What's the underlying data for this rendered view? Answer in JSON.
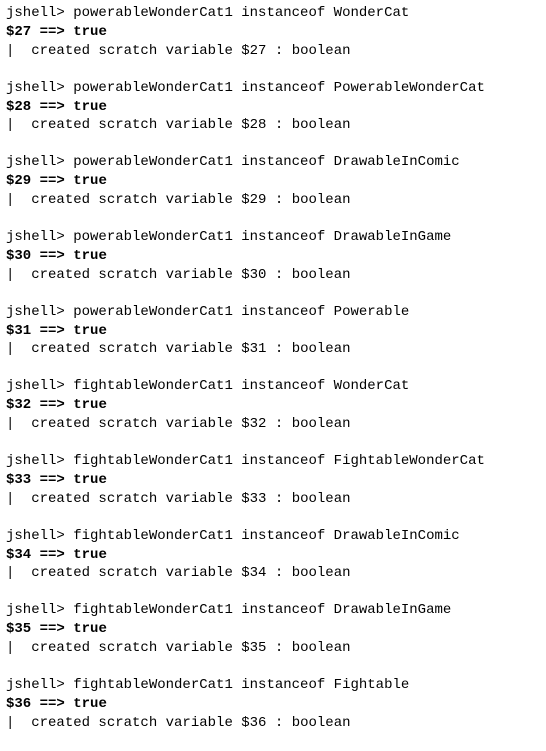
{
  "prompt": "jshell>",
  "arrow": "==>",
  "pipe": "|",
  "created_prefix": "  created scratch variable",
  "created_sep": " :",
  "entries": [
    {
      "cmd": "powerableWonderCat1 instanceof WonderCat",
      "var": "$27",
      "val": "true",
      "type": "boolean"
    },
    {
      "cmd": "powerableWonderCat1 instanceof PowerableWonderCat",
      "var": "$28",
      "val": "true",
      "type": "boolean"
    },
    {
      "cmd": "powerableWonderCat1 instanceof DrawableInComic",
      "var": "$29",
      "val": "true",
      "type": "boolean"
    },
    {
      "cmd": "powerableWonderCat1 instanceof DrawableInGame",
      "var": "$30",
      "val": "true",
      "type": "boolean"
    },
    {
      "cmd": "powerableWonderCat1 instanceof Powerable",
      "var": "$31",
      "val": "true",
      "type": "boolean"
    },
    {
      "cmd": "fightableWonderCat1 instanceof WonderCat",
      "var": "$32",
      "val": "true",
      "type": "boolean"
    },
    {
      "cmd": "fightableWonderCat1 instanceof FightableWonderCat",
      "var": "$33",
      "val": "true",
      "type": "boolean"
    },
    {
      "cmd": "fightableWonderCat1 instanceof DrawableInComic",
      "var": "$34",
      "val": "true",
      "type": "boolean"
    },
    {
      "cmd": "fightableWonderCat1 instanceof DrawableInGame",
      "var": "$35",
      "val": "true",
      "type": "boolean"
    },
    {
      "cmd": "fightableWonderCat1 instanceof Fightable",
      "var": "$36",
      "val": "true",
      "type": "boolean"
    }
  ]
}
